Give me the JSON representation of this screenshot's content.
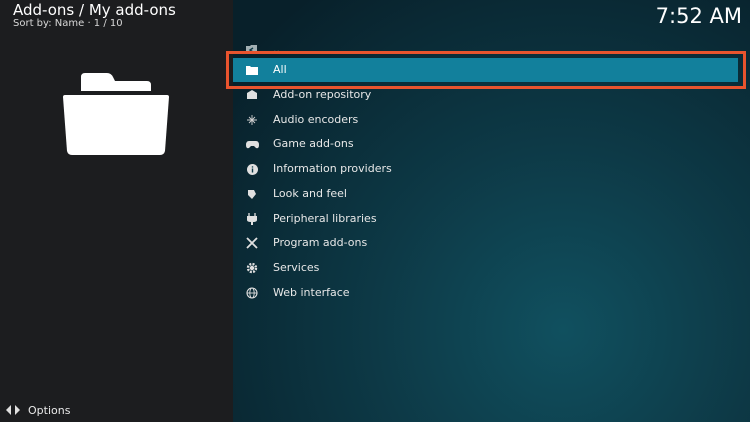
{
  "header": {
    "title": "Add-ons / My add-ons",
    "subtitle": "Sort by: Name  ·  1 / 10"
  },
  "clock": "7:52 AM",
  "menu": {
    "items": [
      {
        "label": "..",
        "icon": "folder-back-icon"
      },
      {
        "label": "All",
        "icon": "folder-icon"
      },
      {
        "label": "Add-on repository",
        "icon": "box-icon"
      },
      {
        "label": "Audio encoders",
        "icon": "sparkle-icon"
      },
      {
        "label": "Game add-ons",
        "icon": "gamepad-icon"
      },
      {
        "label": "Information providers",
        "icon": "info-icon"
      },
      {
        "label": "Look and feel",
        "icon": "paint-icon"
      },
      {
        "label": "Peripheral libraries",
        "icon": "plug-icon"
      },
      {
        "label": "Program add-ons",
        "icon": "tools-icon"
      },
      {
        "label": "Services",
        "icon": "gear-icon"
      },
      {
        "label": "Web interface",
        "icon": "globe-icon"
      }
    ],
    "selected_index": 1
  },
  "footer": {
    "options_label": "Options"
  },
  "colors": {
    "selection": "#12809c",
    "highlight_border": "#e8542e",
    "left_panel": "#1c1d1f"
  }
}
